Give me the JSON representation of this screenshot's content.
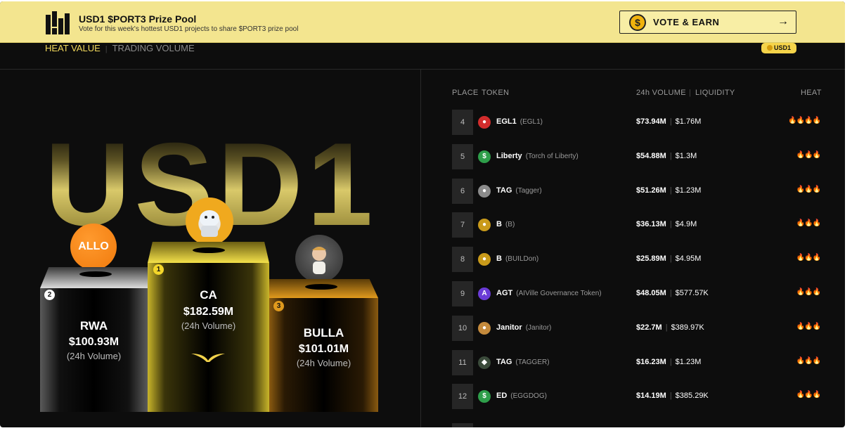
{
  "banner": {
    "title": "USD1 $PORT3 Prize Pool",
    "subtitle": "Vote for this week's hottest USD1 projects to share $PORT3 prize pool",
    "vote_button": "VOTE & EARN",
    "coin_symbol": "$",
    "arrow": "→"
  },
  "tabs": {
    "heat": "HEAT VALUE",
    "separator": "|",
    "volume": "TRADING VOLUME"
  },
  "chip": {
    "label": "USD1"
  },
  "hero_word": "USD1",
  "podium": [
    {
      "rank": "2",
      "name": "RWA",
      "volume": "$100.93M",
      "sub": "(24h Volume)",
      "avatar_text": "ALLO"
    },
    {
      "rank": "1",
      "name": "CA",
      "volume": "$182.59M",
      "sub": "(24h Volume)"
    },
    {
      "rank": "3",
      "name": "BULLA",
      "volume": "$101.01M",
      "sub": "(24h Volume)"
    }
  ],
  "table": {
    "headers": {
      "place": "PLACE",
      "token": "TOKEN",
      "volume": "24h VOLUME",
      "liquidity": "LIQUIDITY",
      "heat": "HEAT"
    },
    "rows": [
      {
        "place": "4",
        "symbol": "EGL1",
        "full": "(EGL1)",
        "volume": "$73.94M",
        "liquidity": "$1.76M",
        "heat": "🔥🔥🔥🔥",
        "icon_color": "#d22c2c",
        "icon_glyph": "●"
      },
      {
        "place": "5",
        "symbol": "Liberty",
        "full": "(Torch of Liberty)",
        "volume": "$54.88M",
        "liquidity": "$1.3M",
        "heat": "🔥🔥🔥",
        "icon_color": "#2e9e4a",
        "icon_glyph": "$"
      },
      {
        "place": "6",
        "symbol": "TAG",
        "full": "(Tagger)",
        "volume": "$51.26M",
        "liquidity": "$1.23M",
        "heat": "🔥🔥🔥",
        "icon_color": "#8b8b8b",
        "icon_glyph": "●"
      },
      {
        "place": "7",
        "symbol": "B",
        "full": "(B)",
        "volume": "$36.13M",
        "liquidity": "$4.9M",
        "heat": "🔥🔥🔥",
        "icon_color": "#c99a1a",
        "icon_glyph": "●"
      },
      {
        "place": "8",
        "symbol": "B",
        "full": "(BUILDon)",
        "volume": "$25.89M",
        "liquidity": "$4.95M",
        "heat": "🔥🔥🔥",
        "icon_color": "#c99a1a",
        "icon_glyph": "●"
      },
      {
        "place": "9",
        "symbol": "AGT",
        "full": "(AIVille Governance Token)",
        "volume": "$48.05M",
        "liquidity": "$577.57K",
        "heat": "🔥🔥🔥",
        "icon_color": "#6a3bd6",
        "icon_glyph": "A"
      },
      {
        "place": "10",
        "symbol": "Janitor",
        "full": "(Janitor)",
        "volume": "$22.7M",
        "liquidity": "$389.97K",
        "heat": "🔥🔥🔥",
        "icon_color": "#c48a3c",
        "icon_glyph": "●"
      },
      {
        "place": "11",
        "symbol": "TAG",
        "full": "(TAGGER)",
        "volume": "$16.23M",
        "liquidity": "$1.23M",
        "heat": "🔥🔥🔥",
        "icon_color": "#3a4a3a",
        "icon_glyph": "◆"
      },
      {
        "place": "12",
        "symbol": "ED",
        "full": "(EGGDOG)",
        "volume": "$14.19M",
        "liquidity": "$385.29K",
        "heat": "🔥🔥🔥",
        "icon_color": "#2e9e4a",
        "icon_glyph": "$"
      }
    ]
  }
}
